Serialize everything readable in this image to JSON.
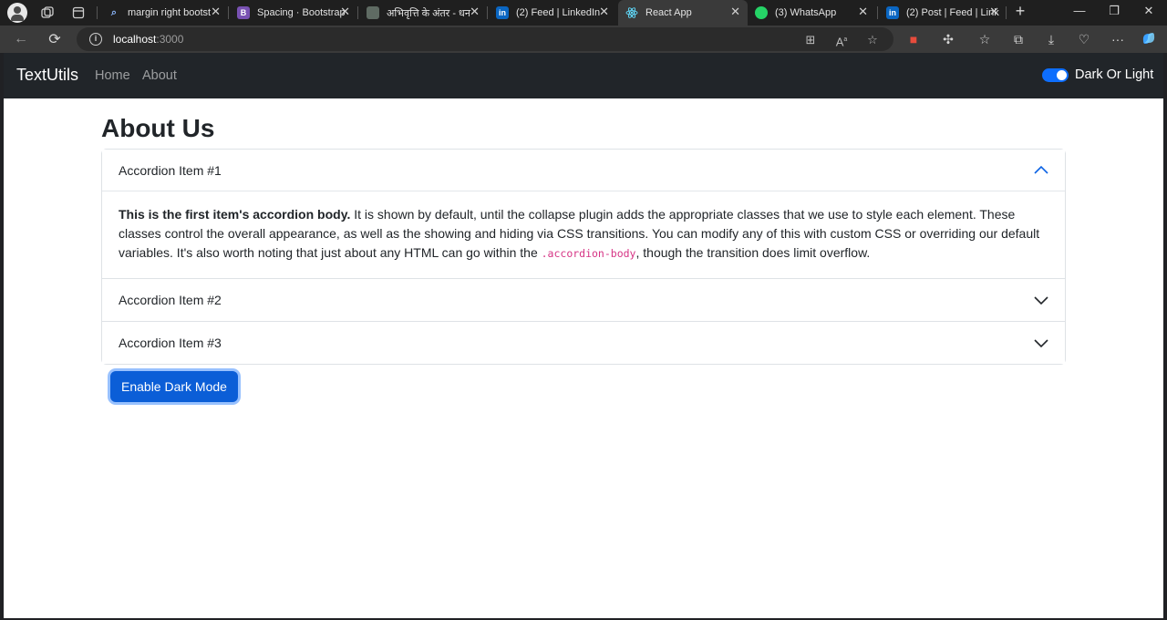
{
  "browser": {
    "tabs": [
      {
        "title": "margin right bootst",
        "favicon": "search-favicon",
        "active": false
      },
      {
        "title": "Spacing · Bootstrap",
        "favicon": "bootstrap-favicon",
        "favicon_text": "B",
        "active": false
      },
      {
        "title": "अभिवृत्ति के अंतर - धन",
        "favicon": "page-favicon",
        "active": false
      },
      {
        "title": "(2) Feed | LinkedIn",
        "favicon": "linkedin-favicon",
        "favicon_text": "in",
        "active": false
      },
      {
        "title": "React App",
        "favicon": "react-favicon",
        "active": true
      },
      {
        "title": "(3) WhatsApp",
        "favicon": "whatsapp-favicon",
        "active": false
      },
      {
        "title": "(2) Post | Feed | Link",
        "favicon": "linkedin-favicon",
        "favicon_text": "in",
        "active": false
      }
    ],
    "address": {
      "host": "localhost",
      "port": ":3000"
    },
    "colors": {
      "tab_strip": "#1f1f1f",
      "toolbar": "#3a3a3a"
    }
  },
  "navbar": {
    "brand": "TextUtils",
    "links": [
      "Home",
      "About"
    ],
    "toggle_label": "Dark Or Light",
    "toggle_on": true
  },
  "main": {
    "title": "About Us",
    "accordion": [
      {
        "header": "Accordion Item #1",
        "open": true,
        "body_strong": "This is the first item's accordion body.",
        "body_text": " It is shown by default, until the collapse plugin adds the appropriate classes that we use to style each element. These classes control the overall appearance, as well as the showing and hiding via CSS transitions. You can modify any of this with custom CSS or overriding our default variables. It's also worth noting that just about any HTML can go within the ",
        "body_code": ".accordion-body",
        "body_tail": ", though the transition does limit overflow."
      },
      {
        "header": "Accordion Item #2",
        "open": false
      },
      {
        "header": "Accordion Item #3",
        "open": false
      }
    ],
    "button_label": "Enable Dark Mode"
  },
  "colors": {
    "navbar": "#212529",
    "primary": "#0b5ed7",
    "code": "#d63384"
  }
}
